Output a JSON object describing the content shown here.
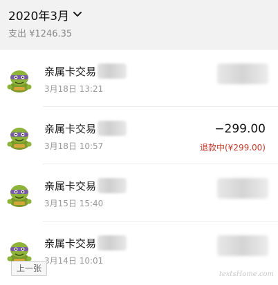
{
  "header": {
    "month_label": "2020年3月",
    "summary": "支出 ¥1246.35"
  },
  "transactions": [
    {
      "title": "亲属卡交易",
      "time": "3月18日 13:21",
      "amount": "",
      "status": ""
    },
    {
      "title": "亲属卡交易",
      "time": "3月18日 10:57",
      "amount": "−299.00",
      "status": "退款中(¥299.00)"
    },
    {
      "title": "亲属卡交易",
      "time": "3月15日 15:40",
      "amount": "",
      "status": ""
    },
    {
      "title": "亲属卡交易",
      "time": "3月14日 10:01",
      "amount": "",
      "status": ""
    }
  ],
  "footer": {
    "prev_label": "上一张",
    "watermark": "textsHome.com"
  },
  "colors": {
    "header_bg": "#f2f2f2",
    "refund_status": "#c0392b",
    "avatar": "olive-green cartoon turtle with purple mask"
  },
  "icons": {
    "month_dropdown": "chevron-down-icon",
    "avatar": "turtle-avatar-icon"
  }
}
